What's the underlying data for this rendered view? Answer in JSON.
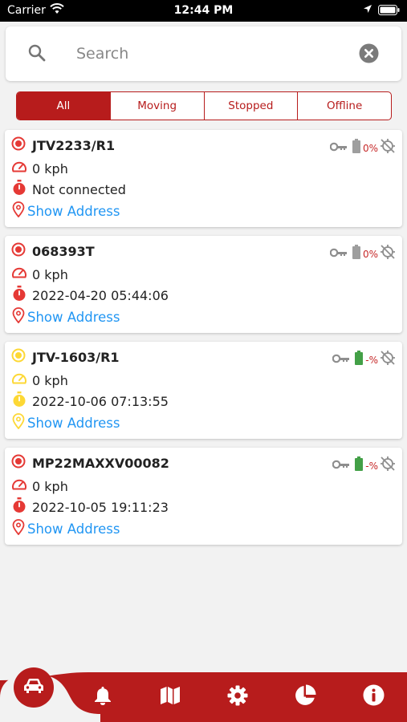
{
  "status_bar": {
    "carrier": "Carrier",
    "time": "12:44 PM"
  },
  "search": {
    "placeholder": "Search",
    "value": ""
  },
  "filters": {
    "tabs": [
      {
        "label": "All",
        "active": true
      },
      {
        "label": "Moving",
        "active": false
      },
      {
        "label": "Stopped",
        "active": false
      },
      {
        "label": "Offline",
        "active": false
      }
    ]
  },
  "vehicles": [
    {
      "name": "JTV2233/R1",
      "speed": "0 kph",
      "last_update": "Not connected",
      "address_link": "Show Address",
      "battery": "0%",
      "status_color": "#e53935",
      "battery_color": "#9e9e9e"
    },
    {
      "name": "068393T",
      "speed": "0 kph",
      "last_update": "2022-04-20 05:44:06",
      "address_link": "Show Address",
      "battery": "0%",
      "status_color": "#e53935",
      "battery_color": "#9e9e9e"
    },
    {
      "name": "JTV-1603/R1",
      "speed": "0 kph",
      "last_update": "2022-10-06 07:13:55",
      "address_link": "Show Address",
      "battery": "-%",
      "status_color": "#fdd835",
      "battery_color": "#43a047"
    },
    {
      "name": "MP22MAXXV00082",
      "speed": "0 kph",
      "last_update": "2022-10-05 19:11:23",
      "address_link": "Show Address",
      "battery": "-%",
      "status_color": "#e53935",
      "battery_color": "#43a047"
    }
  ],
  "bottom_nav": {
    "items": [
      "vehicles-icon",
      "bell-icon",
      "map-icon",
      "gear-icon",
      "pie-chart-icon",
      "info-icon"
    ]
  },
  "colors": {
    "brand": "#b71c1c",
    "link": "#2196f3",
    "background": "#f2f2f2"
  }
}
